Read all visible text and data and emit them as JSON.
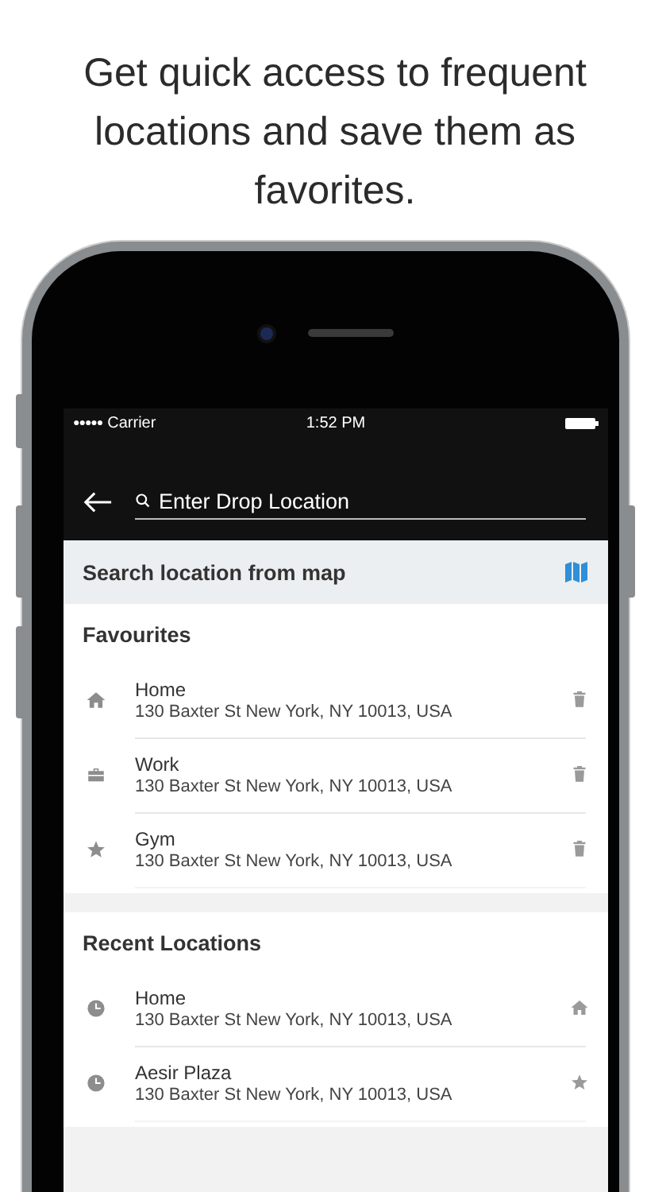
{
  "headline": "Get quick access to frequent locations and save them as favorites.",
  "status_bar": {
    "signal_dots": "●●●●●",
    "carrier": "Carrier",
    "time": "1:52 PM"
  },
  "search": {
    "placeholder": "Enter Drop Location"
  },
  "map_search": {
    "label": "Search location from map"
  },
  "sections": [
    {
      "kind": "favourites",
      "title": "Favourites",
      "items": [
        {
          "kind": "home",
          "title": "Home",
          "address": "130 Baxter St New York, NY 10013, USA"
        },
        {
          "kind": "work",
          "title": "Work",
          "address": "130 Baxter St New York, NY 10013, USA"
        },
        {
          "kind": "starred",
          "title": "Gym",
          "address": "130 Baxter St New York, NY 10013, USA"
        }
      ]
    },
    {
      "kind": "recent",
      "title": "Recent Locations",
      "items": [
        {
          "kind": "home",
          "title": "Home",
          "address": "130 Baxter St New York, NY 10013, USA"
        },
        {
          "kind": "starred",
          "title": "Aesir Plaza",
          "address": "130 Baxter St New York, NY 10013, USA"
        }
      ]
    }
  ]
}
